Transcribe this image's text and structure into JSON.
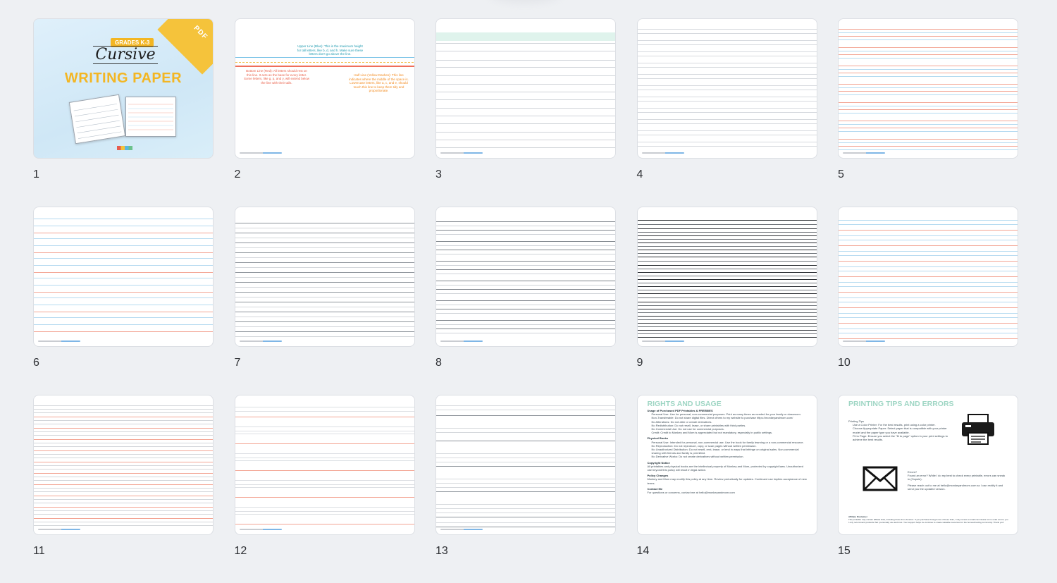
{
  "pages": [
    {
      "number": "1",
      "kind": "cover"
    },
    {
      "number": "2",
      "kind": "guide"
    },
    {
      "number": "3",
      "kind": "ruled-gray"
    },
    {
      "number": "4",
      "kind": "ruled-gray-fine"
    },
    {
      "number": "5",
      "kind": "ruled-red-blue"
    },
    {
      "number": "6",
      "kind": "ruled-red-blue-wide"
    },
    {
      "number": "7",
      "kind": "ruled-gray-dark"
    },
    {
      "number": "8",
      "kind": "ruled-gray-dark-2"
    },
    {
      "number": "9",
      "kind": "ruled-black"
    },
    {
      "number": "10",
      "kind": "ruled-red-blue-fine"
    },
    {
      "number": "11",
      "kind": "ruled-red-gray"
    },
    {
      "number": "12",
      "kind": "ruled-red-light"
    },
    {
      "number": "13",
      "kind": "ruled-gray-wide"
    },
    {
      "number": "14",
      "kind": "rights"
    },
    {
      "number": "15",
      "kind": "printing"
    }
  ],
  "cover": {
    "badge": "PDF",
    "grades": "GRADES K-3",
    "cursive": "Cursive",
    "title": "WRITING PAPER"
  },
  "guide": {
    "upper": "Upper Line (Blue): This is the maximum height for tall letters, like b, d, and h. Make sure these letters don't go above the line.",
    "bottom": "Bottom Line (Red): All letters should rest on this line. It acts as the base for every letter. Some letters, like g, p, and y, will extend below the line with their tails.",
    "half": "Half Line (Yellow Dashes): This line indicates where the middle of the space is. Lowercase letters, like a, c, and e, should touch this line to keep them tidy and proportionate."
  },
  "rights": {
    "title": "RIGHTS AND USAGE",
    "h1": "Usage of Purchased PDF Printables & FREEBIES",
    "l1": "Personal Use: Use for personal, non-commercial purposes. Print as many times as needed for your family or classroom.",
    "l2": "Non-Transferable: Do not share digital files. Direct others to my website to purchase https://monkeyandmom.com/",
    "l3": "No Alterations: Do not alter or create derivatives.",
    "l4": "No Redistribution: Do not resell, lease, or share printables with third parties.",
    "l5": "No Commercial Use: Do not use for commercial purposes.",
    "l6": "Credit: Credit to Monkey and Mom is appreciated but not mandatory, especially in public settings.",
    "h2": "Physical Books",
    "l7": "Personal Use: Intended for personal, non-commercial use. Use the book for family learning or a non-commercial resource.",
    "l8": "No Reproduction: Do not reproduce, copy, or scan pages without written permission.",
    "l9": "No Unauthorized Distribution: Do not resell, rent, lease, or lend in ways that infringe on original sales. Non-commercial sharing with friends and family is permitted.",
    "l10": "No Derivative Works: Do not create derivatives without written permission.",
    "h3": "Copyright Notice",
    "l11": "All printables and physical books are the intellectual property of Monkey and Mom, protected by copyright laws. Unauthorized use beyond this policy will result in legal action.",
    "h4": "Policy Changes",
    "l12": "Monkey and Mom may modify this policy at any time. Review periodically for updates. Continued use implies acceptance of new terms.",
    "h5": "Contact Me",
    "l13": "For questions or concerns, contact me at hello@monkeyandmom.com"
  },
  "printing": {
    "title": "PRINTING TIPS AND ERRORS",
    "h1": "Printing Tips",
    "t1": "Use a Color Printer: For the best results, print using a color printer.",
    "t2": "Choose Appropriate Paper: Select paper that is compatible with your printer model and the paper type you have available.",
    "t3": "Fit to Page: Ensure you select the \"fit to page\" option in your print settings to achieve the best results.",
    "h2": "Errors?",
    "e1": "Found an error? While I do my best to check every printable, errors can sneak in (Oopsie).",
    "e2": "Please reach out to me at hello@monkeyandmom.com so I can rectify it and send you the updated version.",
    "h3": "Affiliate Disclaimer",
    "d1": "This printable may contain affiliate links, including those from Amazon. If you purchase through one of these links, I may receive a small commission at no extra cost to you. I only recommend products that I personally use and trust. Your support helps me continue to create valuable resources for the homeschooling community. Thank you!"
  },
  "colors": {
    "accent": "#f3b623",
    "mint": "#9fd6c4",
    "red": "#f07e6a",
    "blue": "#9fd0ee",
    "teal": "#1f9bb0",
    "orange": "#f28a1e"
  }
}
